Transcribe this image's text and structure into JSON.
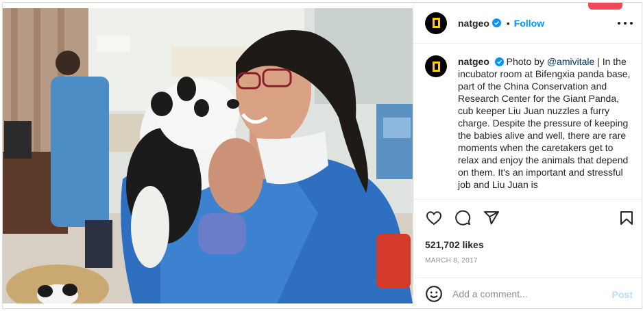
{
  "header": {
    "username": "natgeo",
    "separator": "•",
    "follow_label": "Follow",
    "avatar_icon": "natgeo-logo-icon",
    "verified_icon": "verified-badge-icon",
    "more_icon": "more-options-icon"
  },
  "caption": {
    "username": "natgeo",
    "prefix": "Photo by ",
    "mention": "@amivitale",
    "text": " | In the incubator room at Bifengxia panda base, part of the China Conservation and Research Center for the Giant Panda, cub keeper Liu Juan nuzzles a furry charge. Despite the pressure of keeping the babies alive and well, there are rare moments when the caretakers get to relax and enjoy the animals that depend on them. It's an important and stressful job and Liu Juan is"
  },
  "actions": {
    "like_icon": "heart-icon",
    "comment_icon": "comment-icon",
    "share_icon": "share-icon",
    "save_icon": "bookmark-icon",
    "likes": "521,702 likes",
    "date": "MARCH 8, 2017"
  },
  "comment_bar": {
    "emoji_icon": "emoji-icon",
    "placeholder": "Add a comment...",
    "post_label": "Post"
  },
  "colors": {
    "accent_blue": "#0095f6",
    "post_disabled": "#b2dffc",
    "natgeo_yellow": "#ffcd00",
    "notification_red": "#ed4956"
  }
}
